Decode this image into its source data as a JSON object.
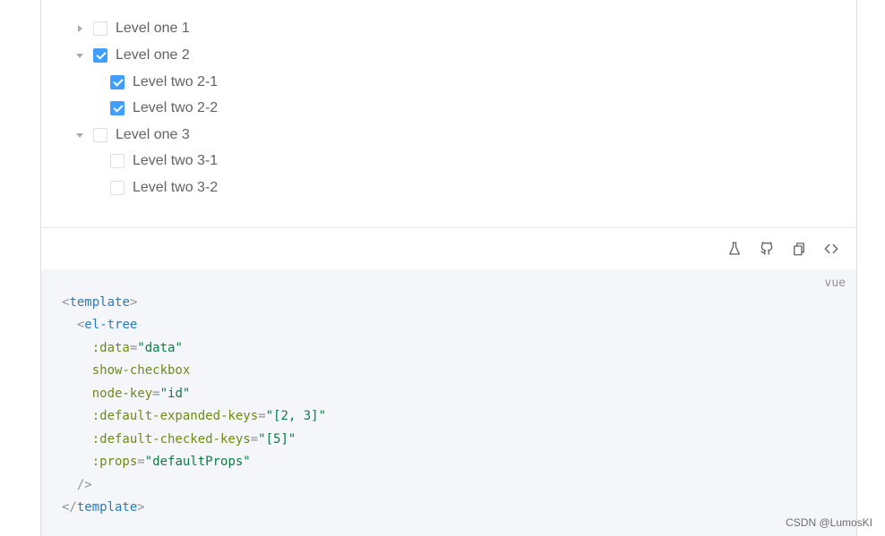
{
  "tree": {
    "nodes": [
      {
        "label": "Level one 1",
        "checked": false,
        "expanded": false
      },
      {
        "label": "Level one 2",
        "checked": true,
        "expanded": true
      },
      {
        "label": "Level two 2-1",
        "checked": true
      },
      {
        "label": "Level two 2-2",
        "checked": true
      },
      {
        "label": "Level one 3",
        "checked": false,
        "expanded": true
      },
      {
        "label": "Level two 3-1",
        "checked": false
      },
      {
        "label": "Level two 3-2",
        "checked": false
      }
    ]
  },
  "toolbar": {
    "icons": [
      "playground-icon",
      "github-icon",
      "copy-icon",
      "code-toggle-icon"
    ]
  },
  "code": {
    "language": "vue",
    "lines": {
      "l1_open": "<",
      "l1_tag": "template",
      "l1_close": ">",
      "l2_open": "<",
      "l2_tag": "el-tree",
      "l3_attr": ":data",
      "l3_eq": "=",
      "l3_val": "\"data\"",
      "l4_attr": "show-checkbox",
      "l5_attr": "node-key",
      "l5_eq": "=",
      "l5_val": "\"id\"",
      "l6_attr": ":default-expanded-keys",
      "l6_eq": "=",
      "l6_val": "\"[2, 3]\"",
      "l7_attr": ":default-checked-keys",
      "l7_eq": "=",
      "l7_val": "\"[5]\"",
      "l8_attr": ":props",
      "l8_eq": "=",
      "l8_val": "\"defaultProps\"",
      "l9_close": "/>",
      "l10_open": "</",
      "l10_tag": "template",
      "l10_close": ">"
    }
  },
  "watermark": "CSDN @LumosKI",
  "colors": {
    "accent": "#409eff",
    "code_bg": "#f5f6fa",
    "tag": "#2d7ab4",
    "attr": "#6e8a16",
    "string": "#0e7a45"
  }
}
